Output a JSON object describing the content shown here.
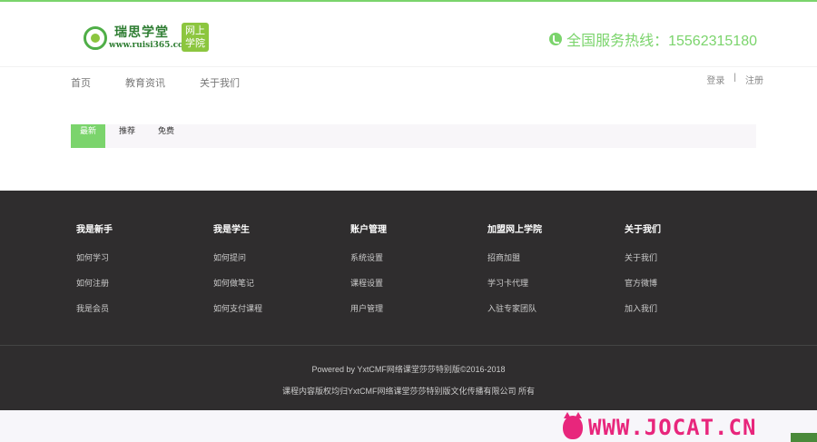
{
  "header": {
    "logo": {
      "brand": "瑞思学堂",
      "url": "www.ruisi365.com",
      "badge": "网上学院"
    },
    "hotline_label": "全国服务热线：15562315180"
  },
  "nav": {
    "items": [
      {
        "label": "首页"
      },
      {
        "label": "教育资讯"
      },
      {
        "label": "关于我们"
      }
    ],
    "login": "登录",
    "separator": "|",
    "register": "注册"
  },
  "filters": {
    "tabs": [
      {
        "label": "最新",
        "active": true
      },
      {
        "label": "推荐",
        "active": false
      },
      {
        "label": "免费",
        "active": false
      }
    ],
    "accent": "#7bd46c"
  },
  "footer": {
    "columns": [
      {
        "title": "我是新手",
        "links": [
          "如何学习",
          "如何注册",
          "我是会员"
        ]
      },
      {
        "title": "我是学生",
        "links": [
          "如何提问",
          "如何做笔记",
          "如何支付课程"
        ]
      },
      {
        "title": "账户管理",
        "links": [
          "系统设置",
          "课程设置",
          "用户管理"
        ]
      },
      {
        "title": "加盟网上学院",
        "links": [
          "招商加盟",
          "学习卡代理",
          "入驻专家团队"
        ]
      },
      {
        "title": "关于我们",
        "links": [
          "关于我们",
          "官方微博",
          "加入我们"
        ]
      }
    ],
    "powered": "Powered by YxtCMF网络课堂莎莎特别版©2016-2018",
    "copyright": "课程内容版权均归YxtCMF网络课堂莎莎特别版文化传播有限公司 所有"
  },
  "watermark": "WWW.JOCAT.CN"
}
